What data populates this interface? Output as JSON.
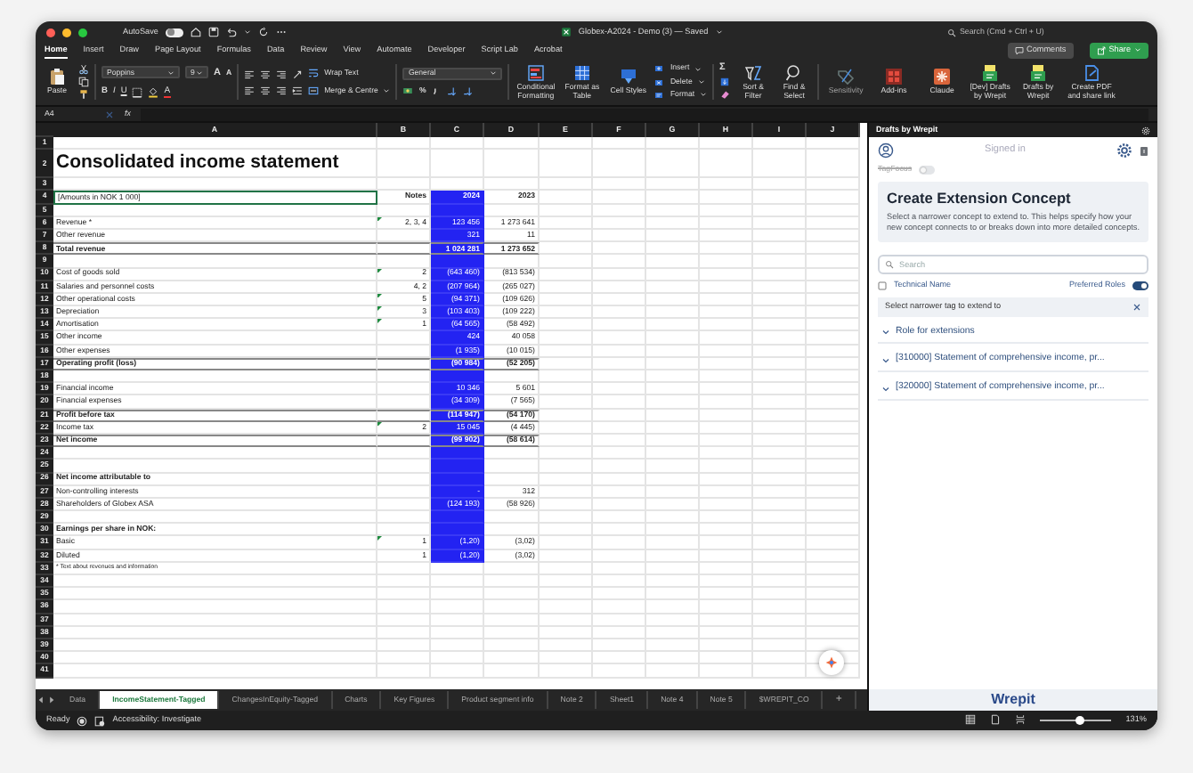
{
  "window": {
    "title": "Globex-A2024 - Demo (3) — Saved",
    "autosave_label": "AutoSave",
    "autosave_on": false,
    "search_placeholder": "Search (Cmd + Ctrl + U)"
  },
  "ribbon_tabs": [
    {
      "label": "Home",
      "selected": true
    },
    {
      "label": "Insert",
      "selected": false
    },
    {
      "label": "Draw",
      "selected": false
    },
    {
      "label": "Page Layout",
      "selected": false
    },
    {
      "label": "Formulas",
      "selected": false
    },
    {
      "label": "Data",
      "selected": false
    },
    {
      "label": "Review",
      "selected": false
    },
    {
      "label": "View",
      "selected": false
    },
    {
      "label": "Automate",
      "selected": false
    },
    {
      "label": "Developer",
      "selected": false
    },
    {
      "label": "Script Lab",
      "selected": false
    },
    {
      "label": "Acrobat",
      "selected": false
    }
  ],
  "ribbon_actions": {
    "comments": "Comments",
    "share": "Share"
  },
  "ribbon": {
    "paste": "Paste",
    "font": "Poppins",
    "font_size": "9",
    "grow_shrink": [
      "A",
      "A"
    ],
    "styles": [
      "B",
      "I",
      "U"
    ],
    "font_color": "A",
    "wrap": "Wrap Text",
    "merge": "Merge & Centre",
    "number_format": "General",
    "percent": "%",
    "sum": "Σ",
    "format_buttons": [
      {
        "label": "Conditional Formatting",
        "disabled": false
      },
      {
        "label": "Format as Table",
        "disabled": false
      },
      {
        "label": "Cell Styles",
        "disabled": false
      }
    ],
    "cell_ops": [
      "Insert",
      "Delete",
      "Format"
    ],
    "edit_buttons": [
      {
        "label": "Sort & Filter",
        "disabled": false
      },
      {
        "label": "Find & Select",
        "disabled": false
      }
    ],
    "addin_buttons": [
      {
        "label": "Sensitivity",
        "disabled": true
      },
      {
        "label": "Add-ins",
        "disabled": false
      },
      {
        "label": "Claude",
        "disabled": false
      },
      {
        "label": "[Dev] Drafts by Wrepit",
        "disabled": false
      },
      {
        "label": "Drafts by Wrepit",
        "disabled": false
      },
      {
        "label": "Create PDF and share link",
        "disabled": false
      }
    ]
  },
  "formula_bar": {
    "name_box": "A4",
    "fx": "fx"
  },
  "sheet": {
    "columns": [
      "A",
      "B",
      "C",
      "D",
      "E",
      "F",
      "G",
      "H",
      "I",
      "J"
    ],
    "rows": [
      {
        "n": "1",
        "kind": "blank",
        "selected": false,
        "highlighted": false,
        "flagged": false
      },
      {
        "n": "2",
        "kind": "title",
        "label": "Consolidated income statement",
        "selected": false,
        "highlighted": false,
        "flagged": false
      },
      {
        "n": "3",
        "kind": "blank",
        "selected": false,
        "highlighted": false,
        "flagged": false
      },
      {
        "n": "4",
        "kind": "header",
        "label": "[Amounts in NOK 1 000]",
        "notes": "Notes",
        "c": "2024",
        "d": "2023",
        "selected": true,
        "highlighted": true,
        "flagged": false
      },
      {
        "n": "5",
        "kind": "blank",
        "selected": false,
        "highlighted": true,
        "flagged": false
      },
      {
        "n": "6",
        "kind": "item",
        "label": "Revenue *",
        "notes": "2, 3, 4",
        "c": "123 456",
        "d": "1 273 641",
        "selected": false,
        "highlighted": true,
        "flagged": true
      },
      {
        "n": "7",
        "kind": "item",
        "label": "Other revenue",
        "c": "321",
        "d": "11",
        "selected": false,
        "highlighted": true,
        "flagged": false
      },
      {
        "n": "8",
        "kind": "total",
        "label": "Total revenue",
        "c": "1 024 281",
        "d": "1 273 652",
        "selected": false,
        "highlighted": true,
        "flagged": false
      },
      {
        "n": "9",
        "kind": "blank",
        "selected": false,
        "highlighted": true,
        "flagged": false
      },
      {
        "n": "10",
        "kind": "item",
        "label": "Cost of goods sold",
        "notes": "2",
        "c": "(643 460)",
        "d": "(813 534)",
        "selected": false,
        "highlighted": true,
        "flagged": true
      },
      {
        "n": "11",
        "kind": "item",
        "label": "Salaries and personnel costs",
        "notes": "4, 2",
        "c": "(207 964)",
        "d": "(265 027)",
        "selected": false,
        "highlighted": true,
        "flagged": false
      },
      {
        "n": "12",
        "kind": "item",
        "label": "Other operational costs",
        "notes": "5",
        "c": "(94 371)",
        "d": "(109 626)",
        "selected": false,
        "highlighted": true,
        "flagged": true
      },
      {
        "n": "13",
        "kind": "item",
        "label": "Depreciation",
        "notes": "3",
        "c": "(103 403)",
        "d": "(109 222)",
        "selected": false,
        "highlighted": true,
        "flagged": true
      },
      {
        "n": "14",
        "kind": "item",
        "label": "Amortisation",
        "notes": "1",
        "c": "(64 565)",
        "d": "(58 492)",
        "selected": false,
        "highlighted": true,
        "flagged": true
      },
      {
        "n": "15",
        "kind": "item",
        "label": "Other income",
        "c": "424",
        "d": "40 058",
        "selected": false,
        "highlighted": true,
        "flagged": false
      },
      {
        "n": "16",
        "kind": "item",
        "label": "Other expenses",
        "c": "(1 935)",
        "d": "(10 015)",
        "selected": false,
        "highlighted": true,
        "flagged": false
      },
      {
        "n": "17",
        "kind": "total",
        "label": "Operating profit (loss)",
        "c": "(90 984)",
        "d": "(52 205)",
        "selected": false,
        "highlighted": true,
        "flagged": false
      },
      {
        "n": "18",
        "kind": "blank",
        "selected": false,
        "highlighted": true,
        "flagged": false
      },
      {
        "n": "19",
        "kind": "item",
        "label": "Financial income",
        "c": "10 346",
        "d": "5 601",
        "selected": false,
        "highlighted": true,
        "flagged": false
      },
      {
        "n": "20",
        "kind": "item",
        "label": "Financial expenses",
        "c": "(34 309)",
        "d": "(7 565)",
        "selected": false,
        "highlighted": true,
        "flagged": false
      },
      {
        "n": "21",
        "kind": "total",
        "label": "Profit before tax",
        "c": "(114 947)",
        "d": "(54 170)",
        "selected": false,
        "highlighted": true,
        "flagged": false
      },
      {
        "n": "22",
        "kind": "item",
        "label": "Income tax",
        "notes": "2",
        "c": "15 045",
        "d": "(4 445)",
        "selected": false,
        "highlighted": true,
        "flagged": true
      },
      {
        "n": "23",
        "kind": "total",
        "label": "Net income",
        "c": "(99 902)",
        "d": "(58 614)",
        "selected": false,
        "highlighted": true,
        "flagged": false
      },
      {
        "n": "24",
        "kind": "blank",
        "selected": false,
        "highlighted": true,
        "flagged": false
      },
      {
        "n": "25",
        "kind": "blank",
        "selected": false,
        "highlighted": true,
        "flagged": false
      },
      {
        "n": "26",
        "kind": "section",
        "label": "Net income attributable to",
        "selected": false,
        "highlighted": true,
        "flagged": false
      },
      {
        "n": "27",
        "kind": "item",
        "label": "Non-controlling interests",
        "c": "-",
        "d": "312",
        "selected": false,
        "highlighted": true,
        "flagged": false
      },
      {
        "n": "28",
        "kind": "item",
        "label": "Shareholders of Globex ASA",
        "c": "(124 193)",
        "d": "(58 926)",
        "selected": false,
        "highlighted": true,
        "flagged": false
      },
      {
        "n": "29",
        "kind": "blank",
        "selected": false,
        "highlighted": true,
        "flagged": false
      },
      {
        "n": "30",
        "kind": "section",
        "label": "Earnings per share in NOK:",
        "selected": false,
        "highlighted": true,
        "flagged": false
      },
      {
        "n": "31",
        "kind": "item",
        "label": "Basic",
        "notes": "1",
        "c": "(1,20)",
        "d": "(3,02)",
        "selected": false,
        "highlighted": true,
        "flagged": true
      },
      {
        "n": "32",
        "kind": "item",
        "label": "Diluted",
        "notes": "1",
        "c": "(1,20)",
        "d": "(3,02)",
        "selected": false,
        "highlighted": true,
        "flagged": false
      },
      {
        "n": "33",
        "kind": "note",
        "label": "* Text about revenues and information",
        "selected": false,
        "highlighted": false,
        "flagged": false
      },
      {
        "n": "34",
        "kind": "blank",
        "selected": false,
        "highlighted": false,
        "flagged": false
      },
      {
        "n": "35",
        "kind": "blank",
        "selected": false,
        "highlighted": false,
        "flagged": false
      },
      {
        "n": "36",
        "kind": "blank",
        "selected": false,
        "highlighted": false,
        "flagged": false
      },
      {
        "n": "37",
        "kind": "blank",
        "selected": false,
        "highlighted": false,
        "flagged": false
      },
      {
        "n": "38",
        "kind": "blank",
        "selected": false,
        "highlighted": false,
        "flagged": false
      },
      {
        "n": "39",
        "kind": "blank",
        "selected": false,
        "highlighted": false,
        "flagged": false
      },
      {
        "n": "40",
        "kind": "blank",
        "selected": false,
        "highlighted": false,
        "flagged": false
      },
      {
        "n": "41",
        "kind": "blank",
        "selected": false,
        "highlighted": false,
        "flagged": false
      }
    ]
  },
  "sheet_tabs": [
    {
      "label": "Data",
      "selected": false
    },
    {
      "label": "IncomeStatement-Tagged",
      "selected": true
    },
    {
      "label": "ChangesInEquity-Tagged",
      "selected": false
    },
    {
      "label": "Charts",
      "selected": false
    },
    {
      "label": "Key Figures",
      "selected": false
    },
    {
      "label": "Product segment info",
      "selected": false
    },
    {
      "label": "Note 2",
      "selected": false
    },
    {
      "label": "Sheet1",
      "selected": false
    },
    {
      "label": "Note 4",
      "selected": false
    },
    {
      "label": "Note 5",
      "selected": false
    },
    {
      "label": "$WREPIT_CO",
      "selected": false
    }
  ],
  "add_sheet": "+",
  "panel": {
    "title": "Drafts by Wrepit",
    "status": "Signed in",
    "tagfocus": {
      "label": "TagFocus",
      "on": false
    },
    "card": {
      "title": "Create Extension Concept",
      "text": "Select a narrower concept to extend to. This helps specify how your new concept connects to or breaks down into more detailed concepts."
    },
    "search_placeholder": "Search",
    "technical_name": {
      "label": "Technical Name",
      "checked": false
    },
    "preferred_roles": {
      "label": "Preferred Roles",
      "on": true
    },
    "list_header": "Select narrower tag to extend to",
    "tree": [
      {
        "label": "Role for extensions"
      },
      {
        "label": "[310000] Statement of comprehensive income, pr..."
      },
      {
        "label": "[320000] Statement of comprehensive income, pr..."
      }
    ],
    "logo": "Wrepit"
  },
  "status_bar": {
    "ready": "Ready",
    "accessibility": "Accessibility: Investigate",
    "zoom": {
      "level": 0.55,
      "reading": "131%"
    }
  }
}
